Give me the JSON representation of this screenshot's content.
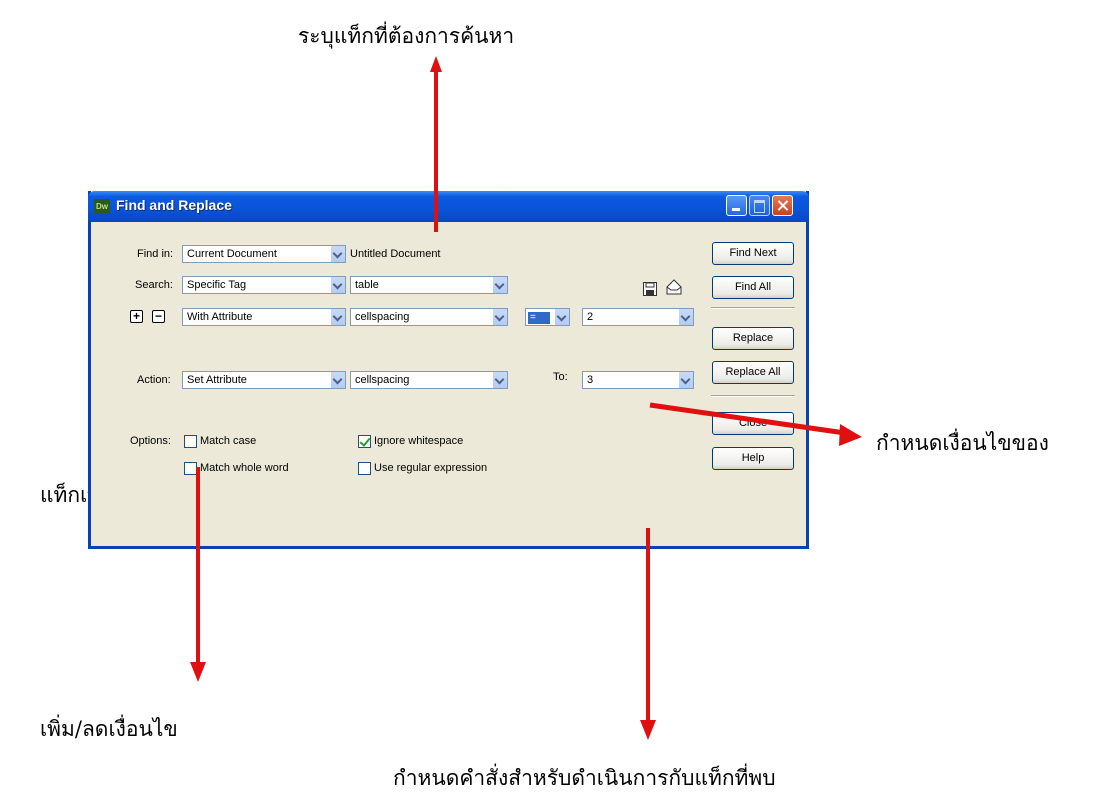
{
  "annotations": {
    "top": "ระบุแท็กที่ต้องการค้นหา",
    "right": "กำหนดเงื่อนไขของ",
    "left": "แท็กเพิ่",
    "bottom_left": "เพิ่ม/ลดเงื่อนไข",
    "bottom_right": "กำหนดคำสั่งสำหรับดำเนินการกับแท็กที่พบ"
  },
  "window": {
    "title": "Find and Replace",
    "icon_text": "Dw"
  },
  "form": {
    "find_in_label": "Find in:",
    "find_in_value": "Current Document",
    "find_in_doc": "Untitled Document",
    "search_label": "Search:",
    "search_value": "Specific Tag",
    "tag_value": "table",
    "condition_value": "With Attribute",
    "attribute_value": "cellspacing",
    "operator_value": "=",
    "attr_value": "2",
    "action_label": "Action:",
    "action_value": "Set Attribute",
    "action_attribute": "cellspacing",
    "to_label": "To:",
    "to_value": "3"
  },
  "options": {
    "label": "Options:",
    "match_case": "Match case",
    "match_whole_word": "Match whole word",
    "ignore_whitespace": "Ignore whitespace",
    "use_regex": "Use regular expression"
  },
  "buttons": {
    "find_next": "Find Next",
    "find_all": "Find All",
    "replace": "Replace",
    "replace_all": "Replace All",
    "close": "Close",
    "help": "Help"
  }
}
